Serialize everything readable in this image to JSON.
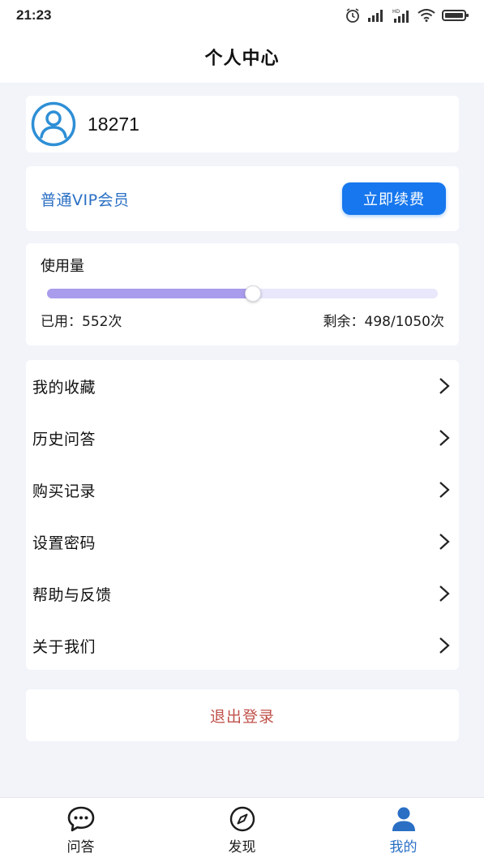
{
  "status_bar": {
    "time": "21:23",
    "signal_hd_label": "HD"
  },
  "header": {
    "title": "个人中心"
  },
  "user": {
    "name": "18271"
  },
  "vip": {
    "label": "普通VIP会员",
    "renew_label": "立即续费"
  },
  "usage": {
    "title": "使用量",
    "used_text": "已用：552次",
    "remaining_text": "剩余：498/1050次",
    "progress_fraction": 0.526
  },
  "menu": {
    "items": [
      {
        "label": "我的收藏"
      },
      {
        "label": "历史问答"
      },
      {
        "label": "购买记录"
      },
      {
        "label": "设置密码"
      },
      {
        "label": "帮助与反馈"
      },
      {
        "label": "关于我们"
      }
    ]
  },
  "logout": {
    "label": "退出登录"
  },
  "tabs": [
    {
      "label": "问答",
      "icon": "chat-bubble-icon",
      "active": false
    },
    {
      "label": "发现",
      "icon": "compass-icon",
      "active": false
    },
    {
      "label": "我的",
      "icon": "person-icon",
      "active": true
    }
  ],
  "colors": {
    "accent": "#1677ee",
    "vip_text": "#2a6fc4",
    "progress_fill": "#a99cec",
    "progress_track": "#e8e7fb",
    "logout_text": "#c0524b"
  }
}
